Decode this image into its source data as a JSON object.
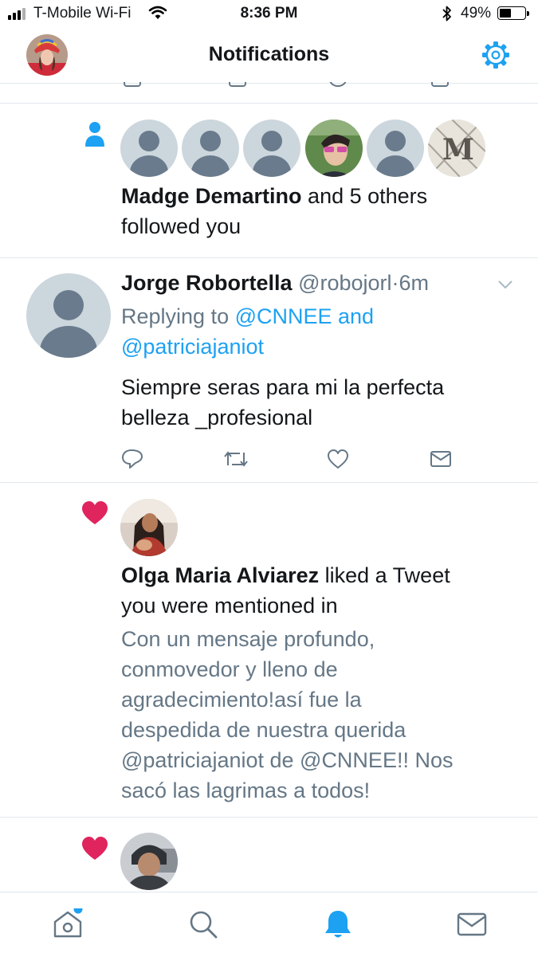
{
  "status_bar": {
    "carrier": "T-Mobile Wi-Fi",
    "time": "8:36 PM",
    "battery": "49%",
    "battery_level": 0.49
  },
  "header": {
    "title": "Notifications",
    "settings_icon": "gear-icon",
    "profile_avatar": "avatar"
  },
  "notifications": [
    {
      "type": "follow",
      "icon": "person-icon",
      "name": "Madge Demartino",
      "line1_rest": " and 5 others",
      "line2": "followed you"
    },
    {
      "type": "reply",
      "name": "Jorge Robortella",
      "handle": "@robojorl",
      "separator": "·",
      "time": "6m",
      "replying_prefix": "Replying to ",
      "replying_to_line1": "@CNNEE and",
      "replying_to_line2": "@patriciajaniot",
      "text_line1": "Siempre seras para mi la perfecta",
      "text_line2": "belleza _profesional",
      "actions": [
        "reply-icon",
        "retweet-icon",
        "like-icon",
        "dm-icon"
      ]
    },
    {
      "type": "like",
      "icon": "heart-icon",
      "name": "Olga Maria Alviarez",
      "line1_rest": " liked a Tweet",
      "line2": "you were mentioned in",
      "tweet_lines": [
        "Con un mensaje profundo,",
        "conmovedor y lleno de",
        "agradecimiento!así fue la",
        "despedida de nuestra querida",
        "@patriciajaniot de @CNNEE!! Nos",
        "sacó las lagrimas a todos!"
      ]
    },
    {
      "type": "like",
      "icon": "heart-icon"
    }
  ],
  "tabbar": {
    "tabs": [
      "home-icon",
      "search-icon",
      "notifications-icon",
      "messages-icon"
    ],
    "active": "notifications-icon"
  },
  "colors": {
    "accent": "#1da1f2",
    "like": "#e0245e",
    "secondary_text": "#657786",
    "divider": "#e1e8ed"
  }
}
